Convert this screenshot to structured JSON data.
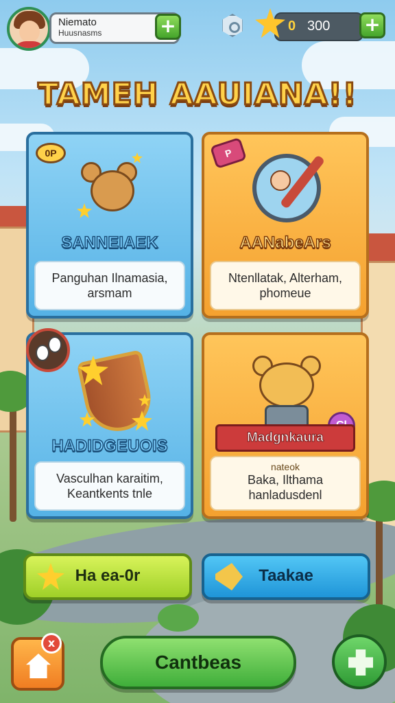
{
  "player": {
    "name": "Niemato",
    "subtitle": "Huusnasms"
  },
  "currency": {
    "glyph": "0",
    "amount": "300"
  },
  "title": "TAMEH AAUIANA!!",
  "cards": [
    {
      "tag": "0P",
      "label": "SANNEIAEK",
      "desc_line1": "Panguhan Ilnamasia,",
      "desc_line2": "arsmam"
    },
    {
      "tag": "P",
      "label": "AANabeArs",
      "desc_line1": "Ntenllatak, Alterham,",
      "desc_line2": "phomeue"
    },
    {
      "label": "HADIDGEUOIS",
      "desc_line1": "Vasculhan karaitim,",
      "desc_line2": "Keantkents tnle"
    },
    {
      "ribbon": "Madgnkaura",
      "badge": "Cl",
      "sub": "nateok",
      "desc_line1": "Baka, Ilthama",
      "desc_line2": "hanladusdenl"
    }
  ],
  "actions": {
    "left_label": "Ha ea-0r",
    "right_label": "Taakae"
  },
  "bottom": {
    "home_badge": "x",
    "main_label": "Cantbeas"
  }
}
